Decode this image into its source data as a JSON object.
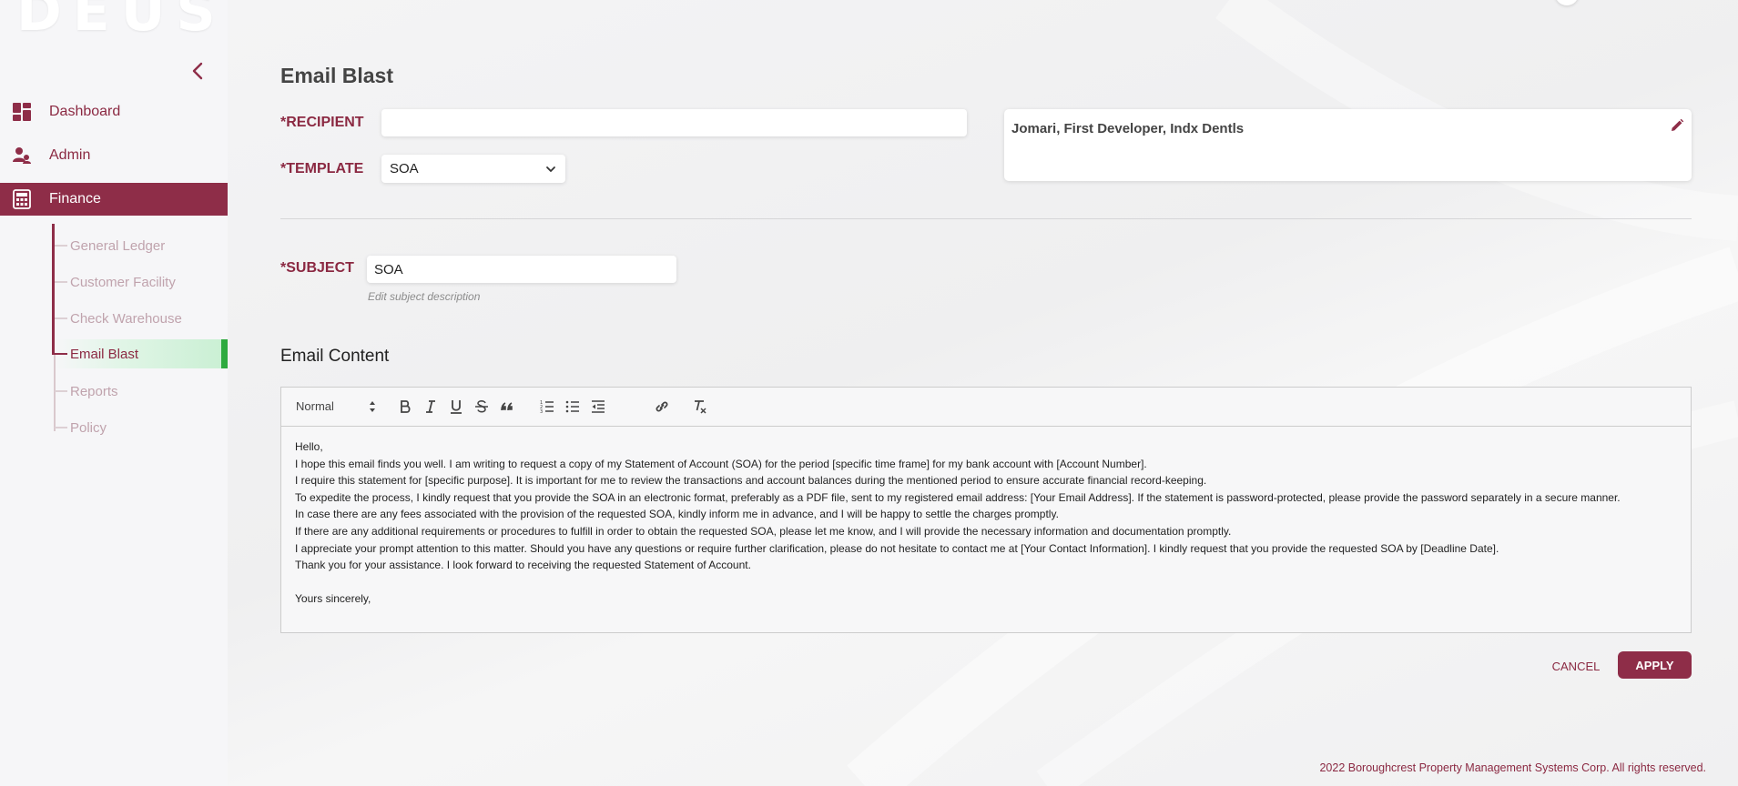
{
  "app": {
    "logo_text": "DEUS",
    "brand_color": "#8e2d48",
    "accent_green": "#2eaa3f"
  },
  "sidebar": {
    "collapse_icon": "chevron-left-icon",
    "items": [
      {
        "label": "Dashboard",
        "icon": "dashboard-icon"
      },
      {
        "label": "Admin",
        "icon": "admin-users-icon"
      },
      {
        "label": "Finance",
        "icon": "finance-calculator-icon",
        "active": true
      }
    ],
    "finance_subitems": [
      {
        "label": "General Ledger"
      },
      {
        "label": "Customer Facility"
      },
      {
        "label": "Check Warehouse"
      },
      {
        "label": "Email Blast",
        "active": true
      },
      {
        "label": "Reports"
      },
      {
        "label": "Policy"
      }
    ]
  },
  "page": {
    "title": "Email Blast",
    "recipient_label": "*RECIPIENT",
    "recipient_value": "",
    "template_label": "*TEMPLATE",
    "template_value": "SOA",
    "recipients_display": "Jomari, First Developer, Indx Dentls",
    "subject_label": "*SUBJECT",
    "subject_value": "SOA",
    "subject_hint": "Edit subject description",
    "content_title": "Email Content"
  },
  "editor": {
    "format_value": "Normal",
    "toolbar_icons": [
      "bold-icon",
      "italic-icon",
      "underline-icon",
      "strikethrough-icon",
      "blockquote-icon",
      "ordered-list-icon",
      "bullet-list-icon",
      "outdent-icon",
      "link-icon",
      "clear-format-icon"
    ],
    "lines": [
      "Hello,",
      "I hope this email finds you well. I am writing to request a copy of my Statement of Account (SOA) for the period [specific time frame] for my bank account with [Account Number].",
      "I require this statement for [specific purpose]. It is important for me to review the transactions and account balances during the mentioned period to ensure accurate financial record-keeping.",
      "To expedite the process, I kindly request that you provide the SOA in an electronic format, preferably as a PDF file, sent to my registered email address: [Your Email Address]. If the statement is password-protected, please provide the password separately in a secure manner.",
      "In case there are any fees associated with the provision of the requested SOA, kindly inform me in advance, and I will be happy to settle the charges promptly.",
      "If there are any additional requirements or procedures to fulfill in order to obtain the requested SOA, please let me know, and I will provide the necessary information and documentation promptly.",
      "I appreciate your prompt attention to this matter. Should you have any questions or require further clarification, please do not hesitate to contact me at [Your Contact Information]. I kindly request that you provide the requested SOA by [Deadline Date].",
      "Thank you for your assistance. I look forward to receiving the requested Statement of Account.",
      "",
      "Yours sincerely,"
    ]
  },
  "actions": {
    "cancel_label": "CANCEL",
    "apply_label": "APPLY"
  },
  "footer": {
    "text": "2022 Boroughcrest Property Management Systems Corp. All rights reserved."
  }
}
